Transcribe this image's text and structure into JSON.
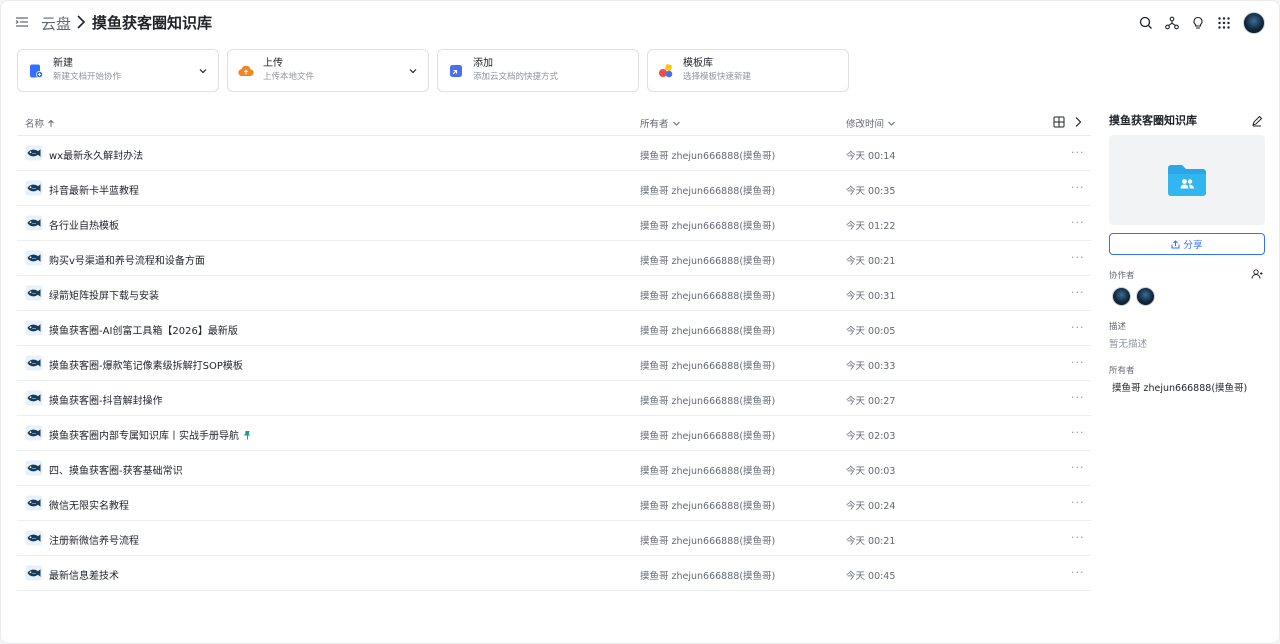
{
  "header": {
    "root": "云盘",
    "current": "摸鱼获客圈知识库"
  },
  "cards": [
    {
      "title": "新建",
      "sub": "新建文档开始协作",
      "icon": "new-doc-icon",
      "color": "#3370ff"
    },
    {
      "title": "上传",
      "sub": "上传本地文件",
      "icon": "upload-icon",
      "color": "#f5841f"
    },
    {
      "title": "添加",
      "sub": "添加云文档的快捷方式",
      "icon": "shortcut-icon",
      "color": "#4e6ef2"
    },
    {
      "title": "模板库",
      "sub": "选择模板快速新建",
      "icon": "template-icon",
      "color": "#f54a45"
    }
  ],
  "table": {
    "col_name": "名称",
    "col_owner": "所有者",
    "col_time": "修改时间",
    "rows": [
      {
        "name": "wx最新永久解封办法",
        "owner": "摸鱼哥 zhejun666888(摸鱼哥)",
        "time": "今天 00:14"
      },
      {
        "name": "抖音最新卡半蓝教程",
        "owner": "摸鱼哥 zhejun666888(摸鱼哥)",
        "time": "今天 00:35"
      },
      {
        "name": "各行业自热模板",
        "owner": "摸鱼哥 zhejun666888(摸鱼哥)",
        "time": "今天 01:22"
      },
      {
        "name": "购买v号渠道和养号流程和设备方面",
        "owner": "摸鱼哥 zhejun666888(摸鱼哥)",
        "time": "今天 00:21"
      },
      {
        "name": "绿箭矩阵投屏下载与安装",
        "owner": "摸鱼哥 zhejun666888(摸鱼哥)",
        "time": "今天 00:31"
      },
      {
        "name": "摸鱼获客圈-AI创富工具箱【2026】最新版",
        "owner": "摸鱼哥 zhejun666888(摸鱼哥)",
        "time": "今天 00:05"
      },
      {
        "name": "摸鱼获客圈-爆款笔记像素级拆解打SOP模板",
        "owner": "摸鱼哥 zhejun666888(摸鱼哥)",
        "time": "今天 00:33"
      },
      {
        "name": "摸鱼获客圈-抖音解封操作",
        "owner": "摸鱼哥 zhejun666888(摸鱼哥)",
        "time": "今天 00:27"
      },
      {
        "name": "摸鱼获客圈内部专属知识库丨实战手册导航",
        "owner": "摸鱼哥 zhejun666888(摸鱼哥)",
        "time": "今天 02:03",
        "pinned": true
      },
      {
        "name": "四、摸鱼获客圈-获客基础常识",
        "owner": "摸鱼哥 zhejun666888(摸鱼哥)",
        "time": "今天 00:03"
      },
      {
        "name": "微信无限实名教程",
        "owner": "摸鱼哥 zhejun666888(摸鱼哥)",
        "time": "今天 00:24"
      },
      {
        "name": "注册新微信养号流程",
        "owner": "摸鱼哥 zhejun666888(摸鱼哥)",
        "time": "今天 00:21"
      },
      {
        "name": "最新信息差技术",
        "owner": "摸鱼哥 zhejun666888(摸鱼哥)",
        "time": "今天 00:45"
      }
    ],
    "more_glyph": "···"
  },
  "side": {
    "title": "摸鱼获客圈知识库",
    "share": "分享",
    "collab_label": "协作者",
    "desc_label": "描述",
    "desc_value": "暂无描述",
    "owner_label": "所有者",
    "owner_value": "摸鱼哥 zhejun666888(摸鱼哥)"
  },
  "colors": {
    "accent": "#3370ff",
    "folder": "#2aa7e6",
    "pin": "#1aa08b"
  }
}
